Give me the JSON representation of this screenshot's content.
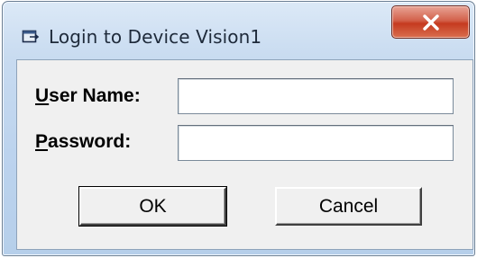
{
  "window": {
    "title": "Login to Device Vision1",
    "icon": "login-window-icon",
    "close_icon": "close-icon",
    "close_color": "#c9462a"
  },
  "form": {
    "username_label_key": "U",
    "username_label_rest": "ser Name:",
    "username_value": "",
    "password_label_key": "P",
    "password_label_rest": "assword:",
    "password_value": ""
  },
  "buttons": {
    "ok_label": "OK",
    "cancel_label": "Cancel"
  }
}
